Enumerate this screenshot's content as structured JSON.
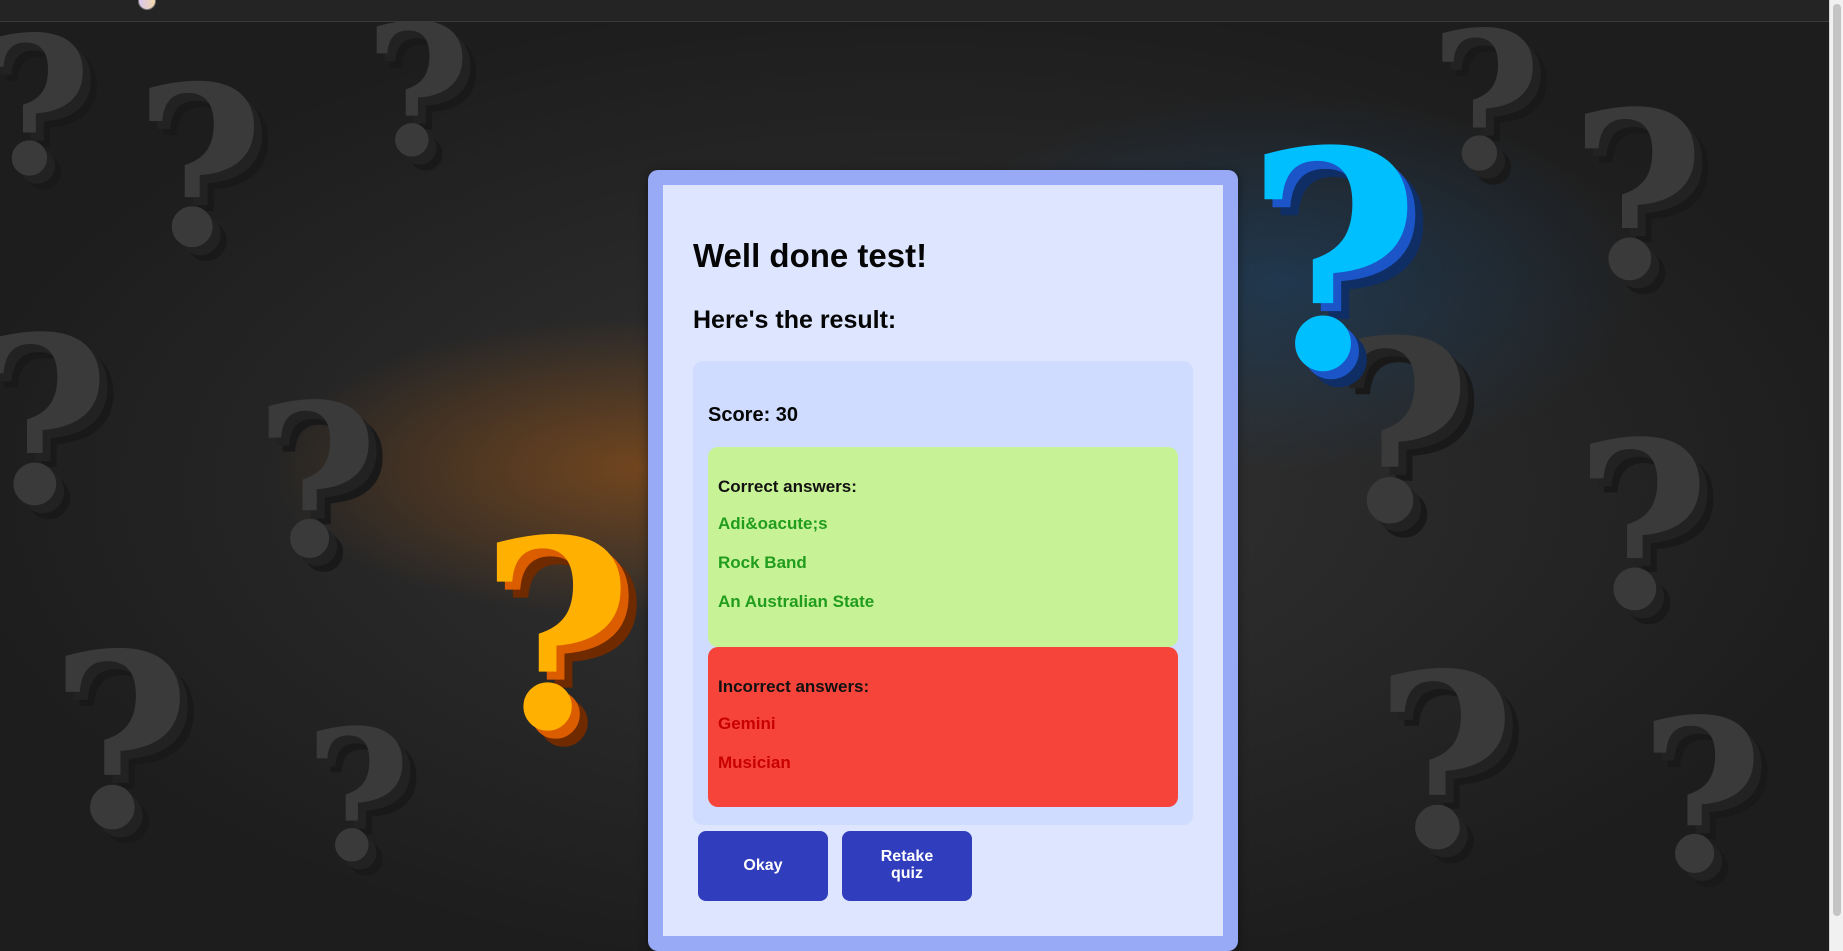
{
  "dialog": {
    "title": "Well done test!",
    "subtitle": "Here's the result:",
    "score_text": "Score: 30",
    "correct": {
      "heading": "Correct answers:",
      "items": [
        "Adi&oacute;s",
        "Rock Band",
        "An Australian State"
      ]
    },
    "incorrect": {
      "heading": "Incorrect answers:",
      "items": [
        "Gemini",
        "Musician"
      ]
    },
    "buttons": {
      "okay": "Okay",
      "retake": "Retake quiz"
    }
  },
  "colors": {
    "dialog_border": "#98a9f5",
    "dialog_bg": "#dde5ff",
    "card_bg": "#cfdcff",
    "correct_bg": "#c8f296",
    "correct_text": "#219d1d",
    "incorrect_bg": "#f6443b",
    "incorrect_text": "#c80000",
    "button_bg": "#303ebd"
  },
  "icons": {
    "topbar_logo": "app-logo-icon"
  }
}
